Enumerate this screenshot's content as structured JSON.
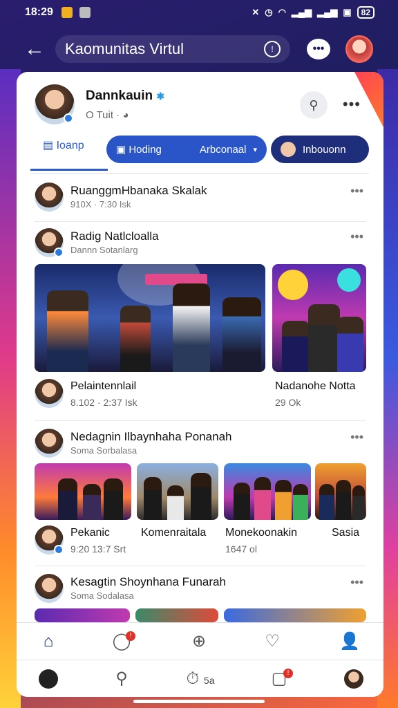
{
  "status_bar": {
    "time": "18:29",
    "battery": "82",
    "icons": [
      "notification-icon",
      "shield-icon",
      "mute-icon",
      "alarm-icon",
      "wifi-icon",
      "signal-icon",
      "signal-icon"
    ]
  },
  "app_bar": {
    "back_icon": "arrow-left-icon",
    "search_text": "Kaomunitas Virtul",
    "search_icon": "search-icon",
    "chat_icon": "chat-bubble-icon"
  },
  "profile": {
    "name": "Dannkauin",
    "verified_mark": "✱",
    "subtitle": "O Tuit ·",
    "more": "•••"
  },
  "tabs": {
    "tab1_label": "Ioanp",
    "pill1_label_a": "Hoding",
    "pill1_label_b": "Arbconaal",
    "pill2_label": "Inbouonn",
    "dropdown_mark": "▾"
  },
  "posts": [
    {
      "title": "RuanggmHbanaka Skalak",
      "meta": "910X · 7:30 Isk"
    },
    {
      "title": "Radig Natlcloalla",
      "meta": "Dannn Sotanlarg"
    },
    {
      "title": "Nedagnin Ilbaynhaha Ponanah",
      "meta": "Soma Sorbalasa"
    },
    {
      "title": "Kesagtin Shoynhana Funarah",
      "meta": "Soma Sodalasa"
    }
  ],
  "captions_row1": [
    {
      "title": "Pelaintennlail",
      "meta": "8.102  · 2:37 Isk"
    },
    {
      "title": "Nadanohe Notta",
      "meta": "29 Ok"
    }
  ],
  "captions_row2": [
    {
      "title": "Pekanic",
      "meta": "9:20  13:7 Srt"
    },
    {
      "title": "Komenraitala",
      "meta": ""
    },
    {
      "title": "Monekoonakin",
      "meta": "1647 ol"
    },
    {
      "title": "Sasia",
      "meta": ""
    }
  ],
  "nav_primary": {
    "items": [
      "home-icon",
      "comment-icon",
      "add-icon",
      "heart-icon",
      "profile-icon"
    ],
    "comment_badge": "!"
  },
  "nav_secondary": {
    "items": [
      "avatar",
      "search-icon",
      "timer-icon",
      "notification-icon",
      "avatar"
    ],
    "timer_label": "5a",
    "notif_badge": "!"
  },
  "colors": {
    "primary": "#2a55c8",
    "navy": "#1e2e7a",
    "badge": "#e0302a"
  }
}
